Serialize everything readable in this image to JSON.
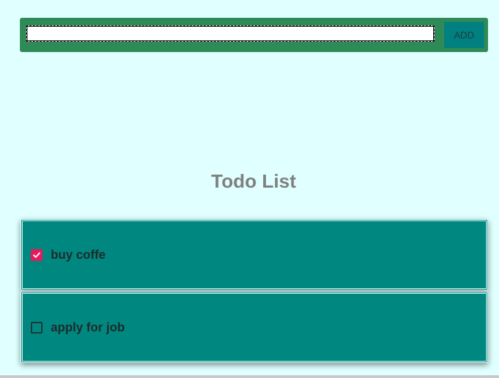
{
  "add_bar": {
    "input_value": "",
    "input_placeholder": "",
    "button_label": "ADD"
  },
  "title": "Todo List",
  "todos": [
    {
      "text": "buy coffe",
      "checked": true
    },
    {
      "text": "apply for job",
      "checked": false
    }
  ],
  "colors": {
    "background": "#e0ffff",
    "add_bar": "#2e8b57",
    "add_button": "#008080",
    "item_background": "#008780",
    "checkbox_checked": "#e8185c",
    "title_text": "#808080"
  }
}
